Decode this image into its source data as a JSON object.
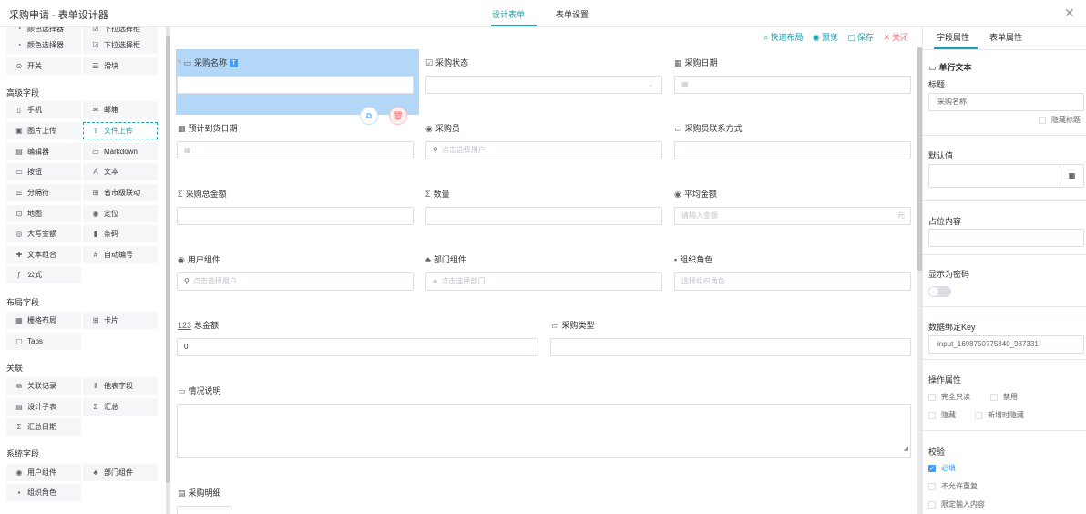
{
  "app": {
    "title": "采购申请 - 表单设计器",
    "close_icon": "close-icon"
  },
  "tabs": [
    {
      "label": "设计表单",
      "active": true
    },
    {
      "label": "表单设置",
      "active": false
    }
  ],
  "palette": {
    "partial_row": [
      {
        "label": "颜色选择器",
        "icon": "◔"
      },
      {
        "label": "下拉选择框",
        "icon": "☑"
      },
      {
        "label": "开关",
        "icon": "⊙"
      },
      {
        "label": "滑块",
        "icon": "☰"
      }
    ],
    "groups": [
      {
        "title": "高级字段",
        "items": [
          {
            "label": "手机",
            "icon": "▯"
          },
          {
            "label": "邮箱",
            "icon": "✉"
          },
          {
            "label": "图片上传",
            "icon": "▣"
          },
          {
            "label": "文件上传",
            "icon": "⇪",
            "highlight": true
          },
          {
            "label": "编辑器",
            "icon": "▤"
          },
          {
            "label": "Markdown",
            "icon": "▭"
          },
          {
            "label": "按钮",
            "icon": "▭"
          },
          {
            "label": "文本",
            "icon": "A"
          },
          {
            "label": "分隔符",
            "icon": "☰"
          },
          {
            "label": "省市级联动",
            "icon": "⊞"
          },
          {
            "label": "地图",
            "icon": "⊡"
          },
          {
            "label": "定位",
            "icon": "◉"
          },
          {
            "label": "大写金额",
            "icon": "◎"
          },
          {
            "label": "条码",
            "icon": "▮"
          },
          {
            "label": "文本组合",
            "icon": "✚"
          },
          {
            "label": "自动编号",
            "icon": "#"
          },
          {
            "label": "公式",
            "icon": "ƒ"
          }
        ]
      },
      {
        "title": "布局字段",
        "items": [
          {
            "label": "栅格布局",
            "icon": "▦"
          },
          {
            "label": "卡片",
            "icon": "⊞"
          },
          {
            "label": "Tabs",
            "icon": "▢"
          }
        ]
      },
      {
        "title": "关联",
        "items": [
          {
            "label": "关联记录",
            "icon": "⧉"
          },
          {
            "label": "他表字段",
            "icon": "Ⅱ"
          },
          {
            "label": "设计子表",
            "icon": "▤"
          },
          {
            "label": "汇总",
            "icon": "Σ"
          },
          {
            "label": "汇总日期",
            "icon": "Σ"
          }
        ]
      },
      {
        "title": "系统字段",
        "items": [
          {
            "label": "用户组件",
            "icon": "◉"
          },
          {
            "label": "部门组件",
            "icon": "♣"
          },
          {
            "label": "组织角色",
            "icon": "▪"
          }
        ]
      }
    ]
  },
  "toolbar": [
    {
      "label": "快速布局",
      "icon": "⌕"
    },
    {
      "label": "预览",
      "icon": "◉"
    },
    {
      "label": "保存",
      "icon": "▢"
    },
    {
      "label": "关闭",
      "icon": "✕",
      "danger": true
    }
  ],
  "fields": [
    {
      "label": "采购名称",
      "icon": "▭",
      "required": true,
      "badge": "T",
      "placeholder": "",
      "selected": true
    },
    {
      "label": "采购状态",
      "icon": "☑",
      "placeholder": "",
      "suffix": "⌄"
    },
    {
      "label": "采购日期",
      "icon": "▦",
      "placeholder": "",
      "prefix": "▦"
    },
    {
      "label": "预计到货日期",
      "icon": "▦",
      "placeholder": "",
      "prefix": "▦"
    },
    {
      "label": "采购员",
      "icon": "◉",
      "placeholder": "点击选择用户",
      "prefix": "⚲"
    },
    {
      "label": "采购员联系方式",
      "icon": "▭",
      "placeholder": ""
    },
    {
      "label": "采购总金额",
      "icon": "Σ",
      "placeholder": ""
    },
    {
      "label": "数量",
      "icon": "Σ",
      "placeholder": ""
    },
    {
      "label": "平均金额",
      "icon": "◉",
      "placeholder": "请输入金额",
      "suffix": "元"
    },
    {
      "label": "用户组件",
      "icon": "◉",
      "placeholder": "点击选择用户",
      "prefix": "⚲"
    },
    {
      "label": "部门组件",
      "icon": "♣",
      "placeholder": "点击选择部门",
      "prefix": "♣"
    },
    {
      "label": "组织角色",
      "icon": "▪",
      "placeholder": "选择组织角色"
    },
    {
      "label": "总金额",
      "icon": "123",
      "value": "0"
    },
    {
      "label": "采购类型",
      "icon": "▭",
      "placeholder": ""
    },
    {
      "label": "情况说明",
      "icon": "▭",
      "placeholder": ""
    },
    {
      "label": "采购明细",
      "icon": "▤"
    }
  ],
  "right_panel": {
    "tabs": [
      {
        "label": "字段属性",
        "active": true
      },
      {
        "label": "表单属性",
        "active": false
      }
    ],
    "component_type": "单行文本",
    "title_label": "标题",
    "title_value": "采购名称",
    "hide_title": "隐藏标题",
    "default_label": "默认值",
    "placeholder_label": "占位内容",
    "password_label": "显示为密码",
    "bind_label": "数据绑定Key",
    "bind_value": "input_1698750775840_987331",
    "ops_label": "操作属性",
    "ops": [
      "完全只读",
      "禁用",
      "隐藏",
      "新增时隐藏"
    ],
    "validate_label": "校验",
    "validate": [
      {
        "label": "必填",
        "checked": true
      },
      {
        "label": "不允许重复",
        "checked": false
      },
      {
        "label": "限定输入内容",
        "checked": false
      }
    ]
  }
}
